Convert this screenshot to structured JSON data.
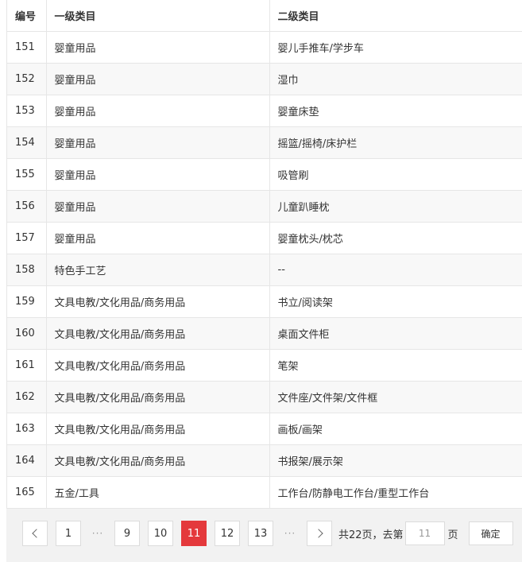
{
  "table": {
    "headers": [
      "编号",
      "一级类目",
      "二级类目"
    ],
    "rows": [
      {
        "id": "151",
        "level1": "婴童用品",
        "level2": "婴儿手推车/学步车"
      },
      {
        "id": "152",
        "level1": "婴童用品",
        "level2": "湿巾"
      },
      {
        "id": "153",
        "level1": "婴童用品",
        "level2": "婴童床垫"
      },
      {
        "id": "154",
        "level1": "婴童用品",
        "level2": "摇篮/摇椅/床护栏"
      },
      {
        "id": "155",
        "level1": "婴童用品",
        "level2": "吸管刷"
      },
      {
        "id": "156",
        "level1": "婴童用品",
        "level2": "儿童趴睡枕"
      },
      {
        "id": "157",
        "level1": "婴童用品",
        "level2": "婴童枕头/枕芯"
      },
      {
        "id": "158",
        "level1": "特色手工艺",
        "level2": "--"
      },
      {
        "id": "159",
        "level1": "文具电教/文化用品/商务用品",
        "level2": "书立/阅读架"
      },
      {
        "id": "160",
        "level1": "文具电教/文化用品/商务用品",
        "level2": "桌面文件柜"
      },
      {
        "id": "161",
        "level1": "文具电教/文化用品/商务用品",
        "level2": "笔架"
      },
      {
        "id": "162",
        "level1": "文具电教/文化用品/商务用品",
        "level2": "文件座/文件架/文件框"
      },
      {
        "id": "163",
        "level1": "文具电教/文化用品/商务用品",
        "level2": "画板/画架"
      },
      {
        "id": "164",
        "level1": "文具电教/文化用品/商务用品",
        "level2": "书报架/展示架"
      },
      {
        "id": "165",
        "level1": "五金/工具",
        "level2": "工作台/防静电工作台/重型工作台"
      }
    ]
  },
  "pagination": {
    "prev_icon": "chevron-left-icon",
    "next_icon": "chevron-right-icon",
    "pages_left": [
      "1"
    ],
    "ellipsis": "···",
    "pages_mid": [
      "9",
      "10",
      "11",
      "12",
      "13"
    ],
    "current_page": "11",
    "total_text": "共22页，去第",
    "input_value": "11",
    "page_unit": "页",
    "confirm_label": "确定",
    "accent_color": "#e4393c"
  }
}
